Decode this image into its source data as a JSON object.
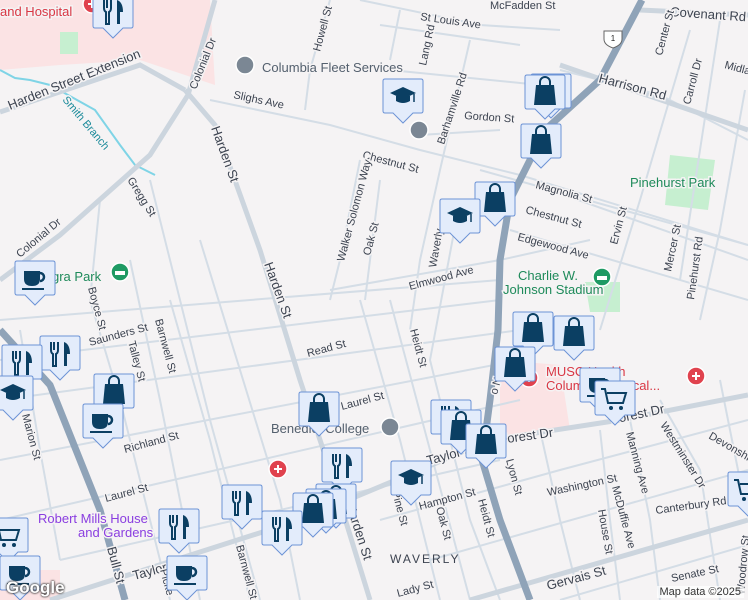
{
  "map": {
    "colors": {
      "background": "#f5f3f4",
      "park": "#c6efd0",
      "hospital_area": "#fbe3e4",
      "highway": "#8fa3b8",
      "marker_fill": "#e3ecfb",
      "marker_border": "#6c93d6",
      "marker_icon": "#0b3f63"
    },
    "labels": {
      "hospital": "and Hospital",
      "fleet": "Columbia Fleet Services",
      "mcfadden": "McFadden St",
      "stlouis": "St Louis Ave",
      "lang": "Lang Rd",
      "covenant": "Covenant Rd",
      "howell": "Howell St",
      "harden_ext": "Harden Street Extension",
      "colonial1": "Colonial Dr",
      "colonial2": "Colonial Dr",
      "slighs": "Slighs Ave",
      "smith": "Smith Branch",
      "harden1": "Harden St",
      "harden2": "Harden St",
      "harden3": "Harden St",
      "barhamville": "Barhamville Rd",
      "gordon": "Gordon St",
      "harrison": "Harrison Rd",
      "center": "Center St",
      "carroll": "Carroll Dr",
      "midla": "Midla",
      "chestnut1": "Chestnut St",
      "magnolia": "Magnolia St",
      "chestnut2": "Chestnut St",
      "edgewood": "Edgewood Ave",
      "pinehurst_park": "Pinehurst Park",
      "ervin": "Ervin St",
      "mercer": "Mercer St",
      "pinehurst_rd": "Pinehurst Rd",
      "walker": "Walker Solomon Way",
      "oak1": "Oak St",
      "waverly_st": "Waverly",
      "elmwood": "Elmwood Ave",
      "stadium1": "Charlie W.",
      "stadium2": "Johnson Stadium",
      "gregg": "Gregg St",
      "allegra": "gra Park",
      "boyce": "Boyce St",
      "saunders": "Saunders St",
      "talley": "Talley St",
      "barnwell1": "Barnwell St",
      "read": "Read St",
      "heidt1": "Heidt St",
      "richland": "Richland St",
      "marion": "Marion St",
      "laurel1": "Laurel St",
      "laurel2": "Laurel St",
      "benedict": "Benedict College",
      "mills1": "Robert Mills House",
      "mills2": "and Gardens",
      "taylor1": "Taylor St",
      "barnwell2": "Barnwell St",
      "taylor2": "Taylor St",
      "hampton": "Hampton St",
      "pine": "Pine St",
      "oak2": "Oak St",
      "heidt2": "Heidt St",
      "lyon": "Lyon St",
      "waverly": "WAVERLY",
      "forest1": "Forest Dr",
      "forest2": "Forest Dr",
      "westminster": "Westminster Dr",
      "devonshire": "Devonshire",
      "manning": "Manning Ave",
      "washington": "Washington St",
      "mcduffie": "McDuffie Ave",
      "house": "House St",
      "canterbury": "Canterbury Rd",
      "gervais": "Gervais St",
      "senate": "Senate St",
      "lady": "Lady St",
      "woodrow": "Woodrow St",
      "musc1": "MUSC Health",
      "musc2": "Columbia Medical...",
      "bull": "Bull St",
      "twonotch": "o Notch",
      "pickens": "Picke",
      "us1": "1"
    },
    "attribution": "Map data ©2025",
    "logo": "Google"
  }
}
